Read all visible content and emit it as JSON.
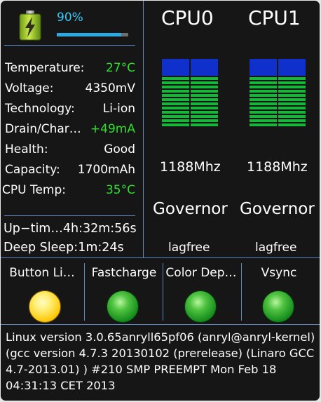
{
  "battery": {
    "percent_label": "90%",
    "level": 0.9,
    "icon": "battery-charging-icon"
  },
  "stats": [
    {
      "label": "Temperature:",
      "value": "27°C",
      "highlight": true
    },
    {
      "label": "Voltage:",
      "value": "4350mV",
      "highlight": false
    },
    {
      "label": "Technology:",
      "value": "Li-ion",
      "highlight": false
    },
    {
      "label": "Drain/Char…",
      "value": "+49mA",
      "highlight": true
    },
    {
      "label": "Health:",
      "value": "Good",
      "highlight": false
    },
    {
      "label": "Capacity:",
      "value": "1700mAh",
      "highlight": false
    }
  ],
  "cpu_temp": {
    "label": "CPU Temp:",
    "value": "35°C"
  },
  "uptime": "Up−tim…4h:32m:56s",
  "deep_sleep": "Deep Sleep:1m:24s",
  "cpus": [
    {
      "name": "CPU0",
      "freq": "1188Mhz",
      "governor_label": "Governor",
      "governor": "lagfree"
    },
    {
      "name": "CPU1",
      "freq": "1188Mhz",
      "governor_label": "Governor",
      "governor": "lagfree"
    }
  ],
  "toggles": [
    {
      "label": "Button Li…",
      "state": "yellow"
    },
    {
      "label": "Fastcharge",
      "state": "green"
    },
    {
      "label": "Color Dep…",
      "state": "green"
    },
    {
      "label": "Vsync",
      "state": "green"
    }
  ],
  "kernel": "Linux version 3.0.65anryll65pf06 (anryl@anryl-kernel) (gcc version 4.7.3 20130102 (prerelease) (Linaro GCC 4.7-2013.01) ) #210 SMP PREEMPT Mon Feb 18 04:31:13 CET 2013",
  "colors": {
    "accent": "#37c8f5",
    "ok": "#2ee02e",
    "divider": "#5d88c8",
    "bar_blue": "#1030cc",
    "bar_green": "#19b53a"
  }
}
